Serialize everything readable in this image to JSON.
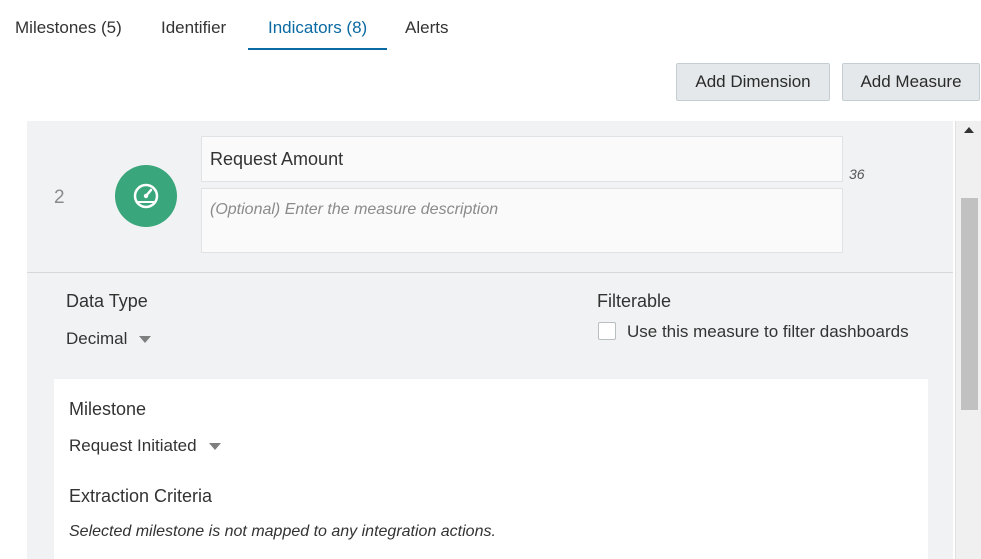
{
  "tabs": [
    {
      "label": "Milestones (5)",
      "active": false
    },
    {
      "label": "Identifier",
      "active": false
    },
    {
      "label": "Indicators (8)",
      "active": true
    },
    {
      "label": "Alerts",
      "active": false
    }
  ],
  "toolbar": {
    "add_dimension_label": "Add Dimension",
    "add_measure_label": "Add Measure"
  },
  "measure": {
    "index": "2",
    "icon": "gauge-icon",
    "icon_color": "#3aa67b",
    "name_value": "Request Amount",
    "description_placeholder": "(Optional) Enter the measure description",
    "char_count": "36",
    "data_type_label": "Data Type",
    "data_type_value": "Decimal",
    "filterable_label": "Filterable",
    "filterable_checkbox_label": "Use this measure to filter dashboards",
    "filterable_checked": false,
    "milestone_label": "Milestone",
    "milestone_value": "Request Initiated",
    "extraction_label": "Extraction Criteria",
    "extraction_note": "Selected milestone is not mapped to any integration actions."
  },
  "colors": {
    "accent": "#0b6aa2",
    "panel_bg": "#f1f2f3",
    "button_bg": "#e4e8ea"
  }
}
